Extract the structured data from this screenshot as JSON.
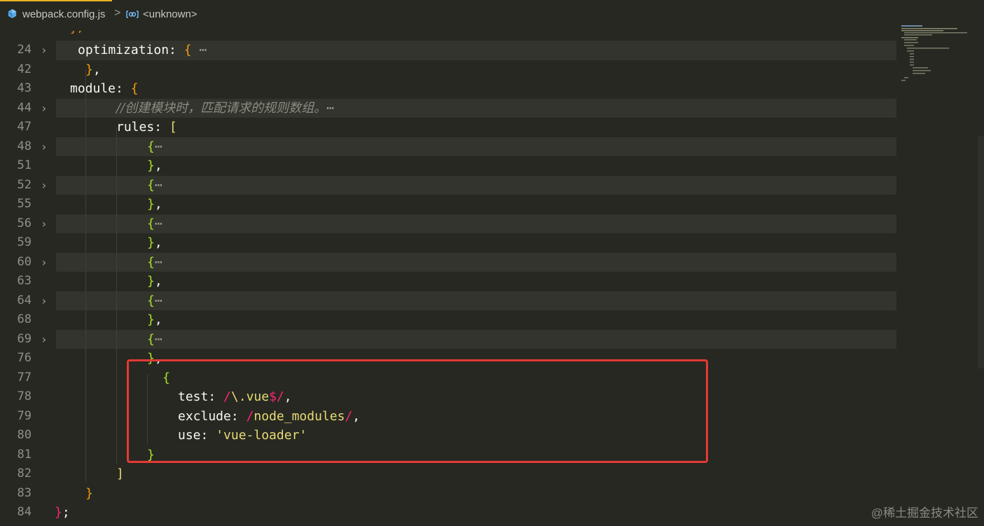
{
  "breadcrumb": {
    "file": "webpack.config.js",
    "separator": ">",
    "symbol": "<unknown>"
  },
  "colors": {
    "background": "#272822",
    "highlight_box": "#e53935",
    "fold_row": "#33342d"
  },
  "icons": {
    "file": "js-file-icon",
    "symbol": "symbol-module-icon",
    "fold": "chevron-right-icon"
  },
  "editor": {
    "partial_line": "};",
    "lines": [
      {
        "num": "24",
        "fold": "›",
        "segments": [
          [
            "k",
            "optimization"
          ],
          [
            "colon",
            ": "
          ],
          [
            "b1",
            "{"
          ],
          [
            "ell",
            " ⋯"
          ]
        ]
      },
      {
        "num": "42",
        "fold": "",
        "segments": [
          [
            "b1",
            "}"
          ],
          [
            "p",
            ","
          ]
        ]
      },
      {
        "num": "43",
        "fold": "",
        "segments": [
          [
            "k",
            "module"
          ],
          [
            "colon",
            ": "
          ],
          [
            "b1",
            "{"
          ]
        ]
      },
      {
        "num": "44",
        "fold": "›",
        "segments": [
          [
            "cm",
            "//创建模块时，匹配请求的规则数组。"
          ],
          [
            "ell",
            "⋯"
          ]
        ]
      },
      {
        "num": "47",
        "fold": "",
        "segments": [
          [
            "k",
            "rules"
          ],
          [
            "colon",
            ": "
          ],
          [
            "b3",
            "["
          ]
        ]
      },
      {
        "num": "48",
        "fold": "›",
        "segments": [
          [
            "b2",
            "{"
          ],
          [
            "ell",
            "⋯"
          ]
        ]
      },
      {
        "num": "51",
        "fold": "",
        "segments": [
          [
            "b2",
            "}"
          ],
          [
            "p",
            ","
          ]
        ]
      },
      {
        "num": "52",
        "fold": "›",
        "segments": [
          [
            "b2",
            "{"
          ],
          [
            "ell",
            "⋯"
          ]
        ]
      },
      {
        "num": "55",
        "fold": "",
        "segments": [
          [
            "b2",
            "}"
          ],
          [
            "p",
            ","
          ]
        ]
      },
      {
        "num": "56",
        "fold": "›",
        "segments": [
          [
            "b2",
            "{"
          ],
          [
            "ell",
            "⋯"
          ]
        ]
      },
      {
        "num": "59",
        "fold": "",
        "segments": [
          [
            "b2",
            "}"
          ],
          [
            "p",
            ","
          ]
        ]
      },
      {
        "num": "60",
        "fold": "›",
        "segments": [
          [
            "b2",
            "{"
          ],
          [
            "ell",
            "⋯"
          ]
        ]
      },
      {
        "num": "63",
        "fold": "",
        "segments": [
          [
            "b2",
            "}"
          ],
          [
            "p",
            ","
          ]
        ]
      },
      {
        "num": "64",
        "fold": "›",
        "segments": [
          [
            "b2",
            "{"
          ],
          [
            "ell",
            "⋯"
          ]
        ]
      },
      {
        "num": "68",
        "fold": "",
        "segments": [
          [
            "b2",
            "}"
          ],
          [
            "p",
            ","
          ]
        ]
      },
      {
        "num": "69",
        "fold": "›",
        "segments": [
          [
            "b2",
            "{"
          ],
          [
            "ell",
            "⋯"
          ]
        ]
      },
      {
        "num": "76",
        "fold": "",
        "segments": [
          [
            "b2",
            "}"
          ],
          [
            "p",
            ","
          ]
        ]
      },
      {
        "num": "77",
        "fold": "",
        "segments": [
          [
            "b2",
            "{"
          ]
        ]
      },
      {
        "num": "78",
        "fold": "",
        "segments": [
          [
            "k",
            "test"
          ],
          [
            "colon",
            ": "
          ],
          [
            "re",
            "/"
          ],
          [
            "str",
            "\\.vue"
          ],
          [
            "re",
            "$/"
          ],
          [
            "p",
            ","
          ]
        ]
      },
      {
        "num": "79",
        "fold": "",
        "segments": [
          [
            "k",
            "exclude"
          ],
          [
            "colon",
            ": "
          ],
          [
            "re",
            "/"
          ],
          [
            "str",
            "node_modules"
          ],
          [
            "re",
            "/"
          ],
          [
            "p",
            ","
          ]
        ]
      },
      {
        "num": "80",
        "fold": "",
        "segments": [
          [
            "k",
            "use"
          ],
          [
            "colon",
            ": "
          ],
          [
            "str",
            "'vue-loader'"
          ]
        ]
      },
      {
        "num": "81",
        "fold": "",
        "segments": [
          [
            "b2",
            "}"
          ]
        ]
      },
      {
        "num": "82",
        "fold": "",
        "segments": [
          [
            "b3",
            "]"
          ]
        ]
      },
      {
        "num": "83",
        "fold": "",
        "segments": [
          [
            "b1",
            "}"
          ]
        ]
      },
      {
        "num": "84",
        "fold": "",
        "segments": [
          [
            "red-b",
            "}"
          ],
          [
            "p",
            ";"
          ]
        ]
      }
    ]
  },
  "watermark": "@稀土掘金技术社区"
}
